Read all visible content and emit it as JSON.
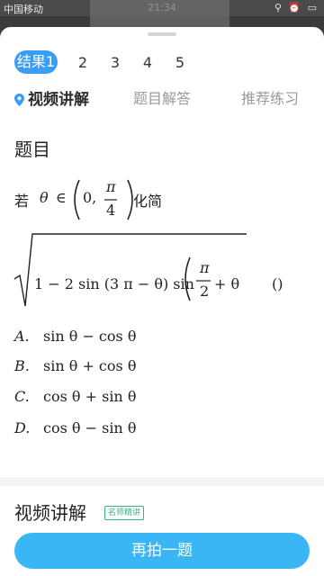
{
  "status_bar": {
    "carrier": "中国移动",
    "time": "21:34",
    "icons": "⚲ ⏰ ▭"
  },
  "result_tabs": [
    "结果1",
    "2",
    "3",
    "4",
    "5"
  ],
  "section_tabs": [
    "视频讲解",
    "题目解答",
    "推荐练习"
  ],
  "question": {
    "heading": "题目",
    "line1_prefix": "若",
    "line1_theta": "θ",
    "line1_in": "∈",
    "line1_zero": "0,",
    "line1_pi": "π",
    "line1_four": "4",
    "line1_suffix": "化简",
    "line2_main": "1 − 2 sin (3 π −  θ) sin",
    "line2_pi": "π",
    "line2_two": "2",
    "line2_plus": "+  θ",
    "line2_blank": "()"
  },
  "options": [
    {
      "letter": "A.",
      "text": "sin θ − cos θ"
    },
    {
      "letter": "B.",
      "text": "sin θ + cos θ"
    },
    {
      "letter": "C.",
      "text": "cos θ + sin θ"
    },
    {
      "letter": "D.",
      "text": "cos θ − sin θ"
    }
  ],
  "video_section": {
    "title": "视频讲解",
    "badge": "名师精讲"
  },
  "retake_button": "再拍一题",
  "colors": {
    "accent": "#3a9df5",
    "button": "#3ab6f5",
    "badge": "#36b37e"
  }
}
